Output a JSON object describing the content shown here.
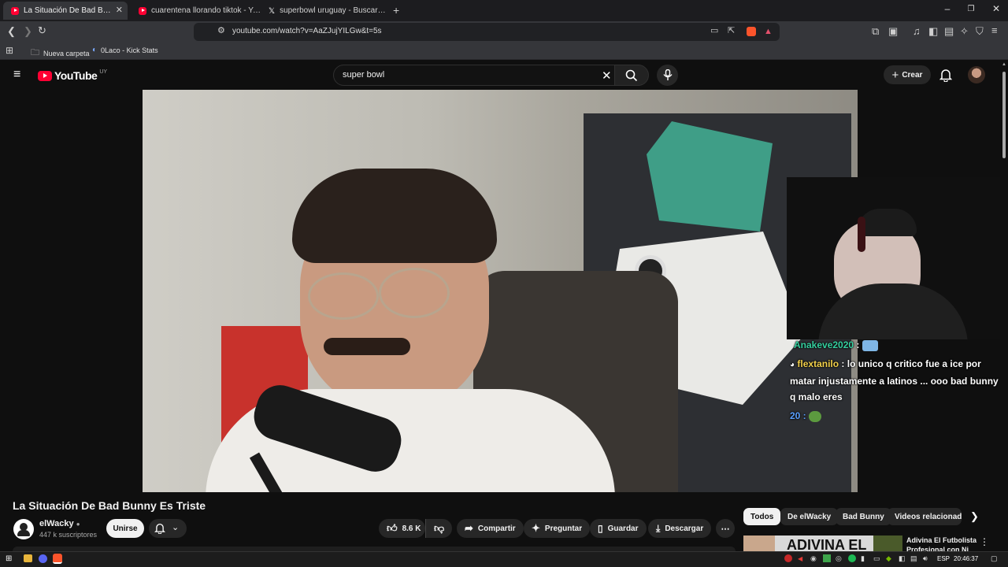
{
  "browser": {
    "tabs": [
      {
        "label": "La Situación De Bad Bunny Es Triste",
        "favicon": "youtube-icon",
        "active": true
      },
      {
        "label": "cuarentena llorando tiktok - YouTube",
        "favicon": "youtube-icon",
        "active": false
      },
      {
        "label": "superbowl uruguay - Buscar / X",
        "favicon": "x-icon",
        "active": false
      }
    ],
    "url": "youtube.com/watch?v=AaZJujYILGw&t=5s",
    "bookmarks": [
      {
        "label": "Nueva carpeta",
        "icon": "folder-icon"
      },
      {
        "label": "0Laco - Kick Stats",
        "icon": "kick-icon"
      }
    ]
  },
  "youtube": {
    "logo_text": "YouTube",
    "region": "UY",
    "search_query": "super bowl",
    "create_label": "Crear",
    "video": {
      "title": "La Situación De Bad Bunny Es Triste",
      "channel": "elWacky",
      "subscribers": "447 k suscriptores",
      "join_label": "Unirse",
      "likes": "8.6 K",
      "share_label": "Compartir",
      "ask_label": "Preguntar",
      "save_label": "Guardar",
      "download_label": "Descargar"
    },
    "chat_overlay": {
      "line1_user": "Anakeve2020",
      "line1_sep": " :",
      "line2_user": "flextanilo",
      "line2_msg": " : lo unico q critico fue a ice por matar injustamente a latinos ... ooo bad bunny q malo eres",
      "line3_text": "20 :"
    },
    "chips": [
      "Todos",
      "De elWacky",
      "Bad Bunny",
      "Videos relacionados"
    ],
    "recommendation": {
      "thumb_text": "ADIVINA EL",
      "title": "Adivina El Futbolista Profesional con Ni"
    }
  },
  "taskbar": {
    "lang": "ESP",
    "time": "20:46:37"
  }
}
